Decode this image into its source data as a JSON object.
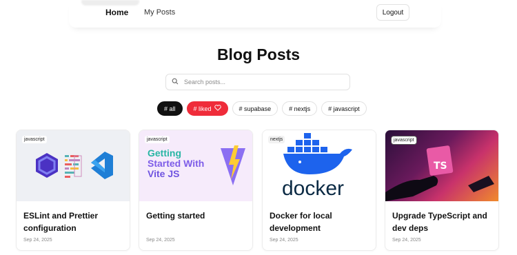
{
  "header": {
    "nav_home": "Home",
    "nav_my_posts": "My Posts",
    "logout_label": "Logout"
  },
  "page": {
    "title": "Blog Posts"
  },
  "search": {
    "placeholder": "Search posts...",
    "value": ""
  },
  "tags": [
    {
      "label": "# all",
      "active": true
    },
    {
      "label": "# liked",
      "icon": "heart-icon"
    },
    {
      "label": "# supabase"
    },
    {
      "label": "# nextjs"
    },
    {
      "label": "# javascript"
    }
  ],
  "posts": [
    {
      "category": "javascript",
      "title": "ESLint and Prettier configuration",
      "date": "Sep 24, 2025",
      "image": "eslint-prettier-vscode-logos"
    },
    {
      "category": "javascript",
      "title": "Getting started",
      "date": "Sep 24, 2025",
      "image": "vite-logo",
      "image_text": [
        "Getting",
        "Started With",
        "Vite JS"
      ]
    },
    {
      "category": "nextjs",
      "title": "Docker for local development",
      "date": "Sep 24, 2025",
      "image": "docker-logo",
      "image_text": "docker"
    },
    {
      "category": "javascript",
      "title": "Upgrade TypeScript and dev deps",
      "date": "Sep 24, 2025",
      "image": "typescript-logo",
      "image_text": "TS"
    }
  ],
  "colors": {
    "accent_liked": "#ef2c3a",
    "active_tag": "#111111",
    "vite_purple": "#7b5cf0",
    "docker_blue": "#1d63ed",
    "ts_pink": "#e95aa6"
  }
}
